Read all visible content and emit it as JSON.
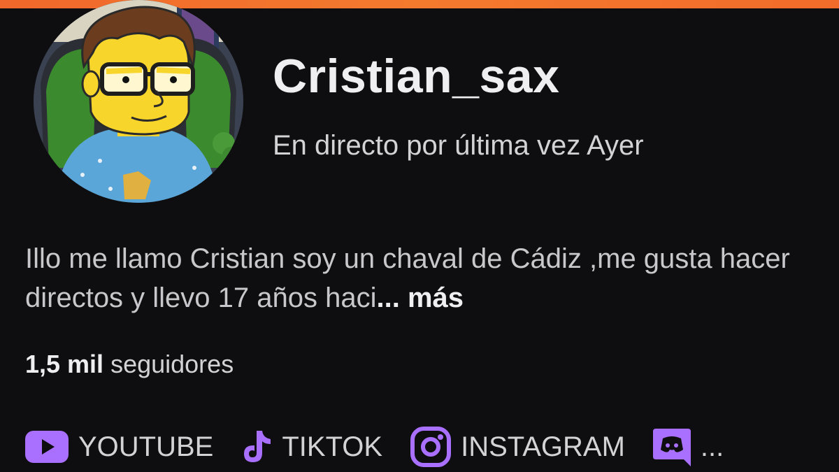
{
  "channel": {
    "name": "Cristian_sax",
    "last_live": "En directo por última vez Ayer"
  },
  "bio": {
    "text": "Illo me llamo Cristian soy un chaval de Cádiz ,me gusta hacer directos y llevo 17 años haci",
    "ellipsis": "...",
    "more_label": "más"
  },
  "followers": {
    "count": "1,5 mil",
    "label": "seguidores"
  },
  "socials": [
    {
      "name": "YOUTUBE",
      "icon": "youtube-icon"
    },
    {
      "name": "TIKTOK",
      "icon": "tiktok-icon"
    },
    {
      "name": "INSTAGRAM",
      "icon": "instagram-icon"
    },
    {
      "name": "...",
      "icon": "discord-icon"
    }
  ],
  "colors": {
    "background": "#0e0e10",
    "accent": "#a970ff",
    "top_bar": "#f47a2e",
    "text": "#efeff1"
  }
}
